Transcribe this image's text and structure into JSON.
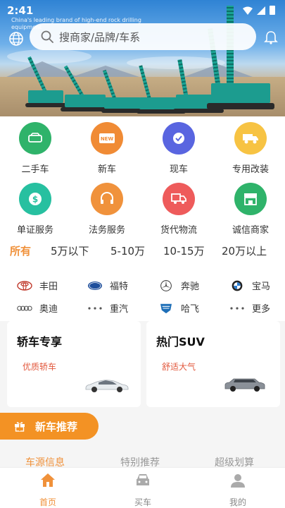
{
  "status_bar": {
    "time": "2:41"
  },
  "banner": {
    "watermark": "China's leading brand of high-end rock drilling equipment"
  },
  "search": {
    "placeholder": "搜商家/品牌/车系"
  },
  "services": [
    {
      "label": "二手车",
      "color": "#2fb36a",
      "icon": "car-icon"
    },
    {
      "label": "新车",
      "color": "#f08b35",
      "icon": "new-badge-icon"
    },
    {
      "label": "现车",
      "color": "#5965e0",
      "icon": "check-circle-icon"
    },
    {
      "label": "专用改装",
      "color": "#f7c343",
      "icon": "truck-icon"
    },
    {
      "label": "单证服务",
      "color": "#27c0a0",
      "icon": "dollar-icon"
    },
    {
      "label": "法务服务",
      "color": "#f0923c",
      "icon": "headset-icon"
    },
    {
      "label": "货代物流",
      "color": "#ee5b5b",
      "icon": "delivery-truck-icon"
    },
    {
      "label": "诚信商家",
      "color": "#2fb36a",
      "icon": "store-icon"
    }
  ],
  "price_tabs": [
    "所有",
    "5万以下",
    "5-10万",
    "10-15万",
    "20万以上"
  ],
  "brands": [
    {
      "label": "丰田",
      "icon": "toyota-logo-icon"
    },
    {
      "label": "福特",
      "icon": "ford-logo-icon"
    },
    {
      "label": "奔驰",
      "icon": "mercedes-logo-icon"
    },
    {
      "label": "宝马",
      "icon": "bmw-logo-icon"
    },
    {
      "label": "奥迪",
      "icon": "audi-logo-icon"
    },
    {
      "label": "重汽",
      "icon": "more-dots-icon"
    },
    {
      "label": "哈飞",
      "icon": "hafei-logo-icon"
    },
    {
      "label": "更多",
      "icon": "more-dots-icon"
    }
  ],
  "promos": [
    {
      "title": "轿车专享",
      "subtitle": "优质轿车"
    },
    {
      "title": "热门SUV",
      "subtitle": "舒适大气"
    }
  ],
  "section": {
    "title": "新车推荐"
  },
  "sub_tabs": [
    "车源信息",
    "特别推荐",
    "超级划算"
  ],
  "nav": [
    {
      "label": "首页",
      "icon": "home-icon"
    },
    {
      "label": "买车",
      "icon": "car-front-icon"
    },
    {
      "label": "我的",
      "icon": "user-icon"
    }
  ],
  "colors": {
    "accent": "#f0913a",
    "badge": "#f39224",
    "promo_sub": "#e2583d"
  }
}
